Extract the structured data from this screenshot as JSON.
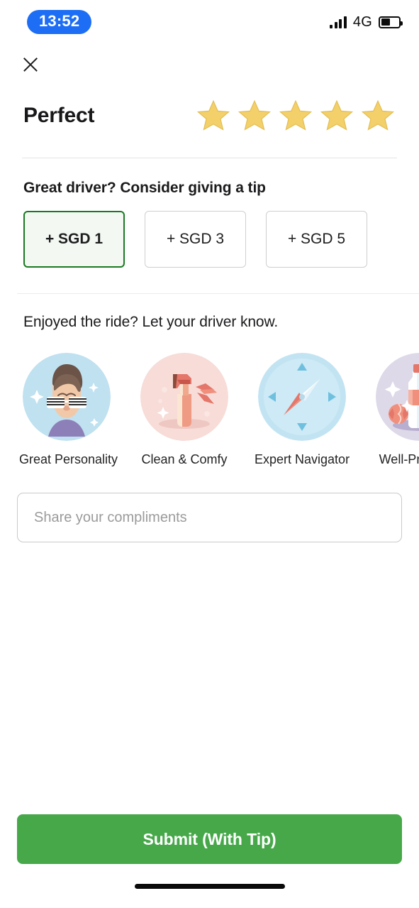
{
  "status_bar": {
    "time": "13:52",
    "time_pill_color": "#1d6ef5",
    "network": "4G",
    "signal_icon": "signal-bars-icon",
    "battery_icon": "battery-icon",
    "battery_level_percent": 50
  },
  "header": {
    "close_icon": "close-x-icon",
    "rating_label": "Perfect",
    "rating_value": 5,
    "rating_max": 5,
    "star_color": "#f3d06a",
    "star_icon": "star-icon"
  },
  "tip": {
    "heading": "Great driver? Consider giving a tip",
    "selected_index": 0,
    "selected_border_color": "#1a7a22",
    "selected_fill_color": "#f3f8f3",
    "options": [
      {
        "label": "+ SGD 1",
        "selected": true
      },
      {
        "label": "+ SGD 3",
        "selected": false
      },
      {
        "label": "+ SGD 5",
        "selected": false
      }
    ]
  },
  "compliments": {
    "heading": "Enjoyed the ride? Let your driver know.",
    "items": [
      {
        "label": "Great Personality",
        "icon": "face-with-shutter-shades-icon",
        "circle_color": "#bfe1f0"
      },
      {
        "label": "Clean & Comfy",
        "icon": "spray-bottle-icon",
        "circle_color": "#f7dcd8"
      },
      {
        "label": "Expert Navigator",
        "icon": "compass-icon",
        "circle_color": "#c2e4f2"
      },
      {
        "label": "Well-Prepared",
        "icon": "water-bottle-and-candy-icon",
        "circle_color": "#ddd9e8"
      }
    ],
    "input_placeholder": "Share your compliments",
    "input_value": ""
  },
  "footer": {
    "submit_label": "Submit (With Tip)",
    "submit_color": "#47a84a",
    "home_indicator": "home-indicator"
  }
}
